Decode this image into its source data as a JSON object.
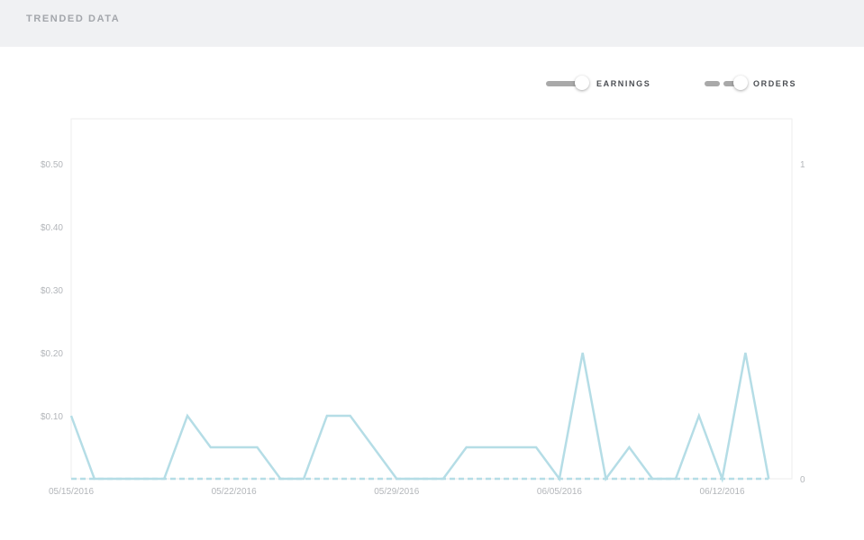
{
  "header": {
    "title": "TRENDED DATA"
  },
  "toggles": [
    {
      "label": "EARNINGS",
      "on": true
    },
    {
      "label": "ORDERS",
      "on": true
    }
  ],
  "colors": {
    "line": "#b5dde6",
    "frame": "#eeeeee",
    "tick": "#b3b6ba",
    "header_bg": "#f0f1f3"
  },
  "chart_data": {
    "type": "line",
    "x": [
      "05/15/2016",
      "05/16/2016",
      "05/17/2016",
      "05/18/2016",
      "05/19/2016",
      "05/20/2016",
      "05/21/2016",
      "05/22/2016",
      "05/23/2016",
      "05/24/2016",
      "05/25/2016",
      "05/26/2016",
      "05/27/2016",
      "05/28/2016",
      "05/29/2016",
      "05/30/2016",
      "05/31/2016",
      "06/01/2016",
      "06/02/2016",
      "06/03/2016",
      "06/04/2016",
      "06/05/2016",
      "06/06/2016",
      "06/07/2016",
      "06/08/2016",
      "06/09/2016",
      "06/10/2016",
      "06/11/2016",
      "06/12/2016",
      "06/13/2016",
      "06/14/2016",
      "06/15/2016"
    ],
    "x_tick_labels": [
      "05/15/2016",
      "05/22/2016",
      "05/29/2016",
      "06/05/2016",
      "06/12/2016"
    ],
    "series": [
      {
        "axis": "left",
        "style": "solid",
        "values": [
          0.1,
          0,
          0,
          0,
          0,
          0.1,
          0.05,
          0.05,
          0.05,
          0,
          0,
          0.1,
          0.1,
          0.05,
          0,
          0,
          0,
          0.05,
          0.05,
          0.05,
          0.05,
          0,
          0.2,
          0,
          0.05,
          0,
          0,
          0.1,
          0,
          0.2,
          0,
          null
        ]
      },
      {
        "axis": "right",
        "style": "dashed",
        "values": [
          0,
          0,
          0,
          0,
          0,
          0,
          0,
          0,
          0,
          0,
          0,
          0,
          0,
          0,
          0,
          0,
          0,
          0,
          0,
          0,
          0,
          0,
          0,
          0,
          0,
          0,
          0,
          0,
          0,
          0,
          0,
          null
        ]
      }
    ],
    "y_left": {
      "ticks": [
        0.1,
        0.2,
        0.3,
        0.4,
        0.5
      ],
      "tick_labels": [
        "$0.10",
        "$0.20",
        "$0.30",
        "$0.40",
        "$0.50"
      ],
      "ylim": [
        0,
        0.5714
      ]
    },
    "y_right": {
      "ticks": [
        0,
        1
      ],
      "tick_labels": [
        "0",
        "1"
      ],
      "ylim": [
        0,
        1.1428
      ]
    },
    "grid": false,
    "legend": "top-right"
  }
}
